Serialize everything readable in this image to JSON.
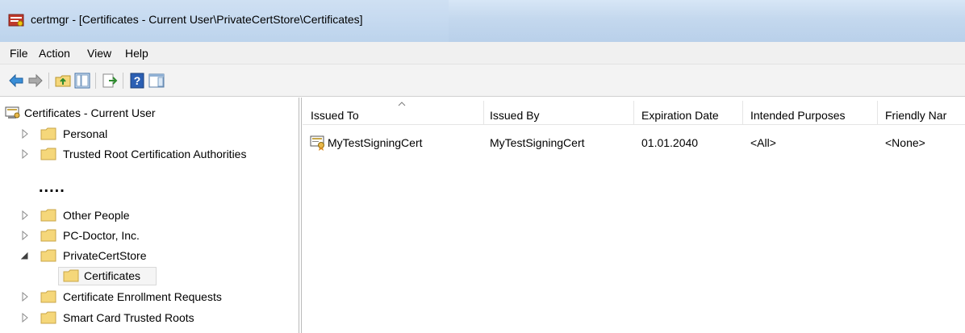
{
  "window": {
    "title": "certmgr - [Certificates - Current User\\PrivateCertStore\\Certificates]",
    "app_icon": "certificate-manager-icon"
  },
  "menu": [
    "File",
    "Action",
    "View",
    "Help"
  ],
  "toolbar": {
    "buttons": [
      "back-arrow-icon",
      "forward-arrow-icon",
      "up-folder-icon",
      "show-hide-console-tree-icon",
      "export-list-icon",
      "help-icon",
      "action-pane-icon"
    ]
  },
  "tree": {
    "root": "Certificates - Current User",
    "items_top": [
      "Personal",
      "Trusted Root Certification Authorities"
    ],
    "gap": ".....",
    "items_bottom": [
      "Other People",
      "PC-Doctor, Inc.",
      "PrivateCertStore"
    ],
    "selected_child": "Certificates",
    "items_after": [
      "Certificate Enrollment Requests",
      "Smart Card Trusted Roots"
    ]
  },
  "list": {
    "columns": [
      "Issued To",
      "Issued By",
      "Expiration Date",
      "Intended Purposes",
      "Friendly Nar"
    ],
    "rows": [
      [
        "MyTestSigningCert",
        "MyTestSigningCert",
        "01.01.2040",
        "<All>",
        "<None>"
      ]
    ]
  },
  "colors": {
    "titlebar": "#c4d8ee",
    "folder": "#f5d77a",
    "selection_border": "#d9d9d9"
  }
}
